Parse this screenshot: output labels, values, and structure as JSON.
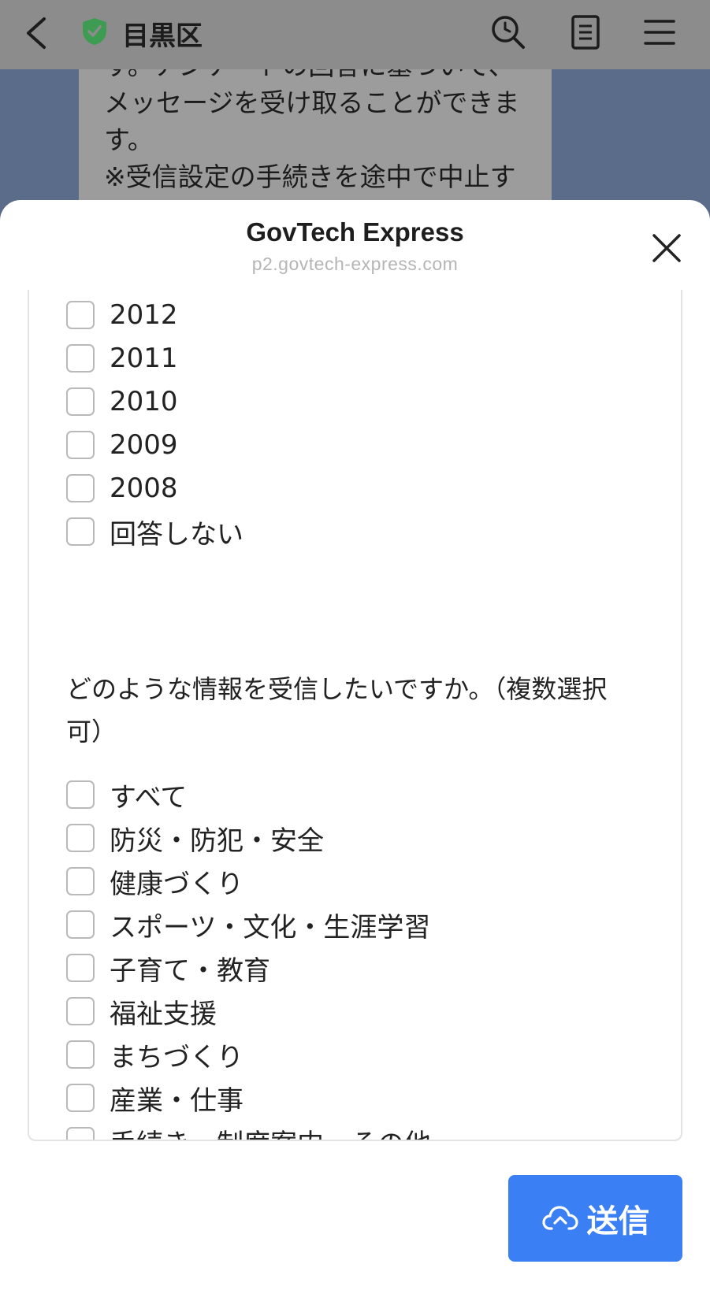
{
  "chat_header": {
    "title": "目黒区"
  },
  "chat_bubble": {
    "text": "す。アンケートの回答に基づいて、メッセージを受け取ることができます。\n※受信設定の手続きを途中で中止する場合は、「中止」と入力してく"
  },
  "modal": {
    "title": "GovTech Express",
    "url": "p2.govtech-express.com"
  },
  "year_options": [
    "2012",
    "2011",
    "2010",
    "2009",
    "2008",
    "回答しない"
  ],
  "question": "どのような情報を受信したいですか。（複数選択可）",
  "info_options": [
    "すべて",
    "防災・防犯・安全",
    "健康づくり",
    "スポーツ・文化・生涯学習",
    "子育て・教育",
    "福祉支援",
    "まちづくり",
    "産業・仕事",
    "手続き・制度案内・その他"
  ],
  "submit": {
    "label": "送信",
    "icon": "cloud-upload-icon"
  },
  "colors": {
    "submit_blue": "#3b7ff5",
    "shield_green": "#3e9b52",
    "dim_overlay": "#8c8c8c"
  }
}
